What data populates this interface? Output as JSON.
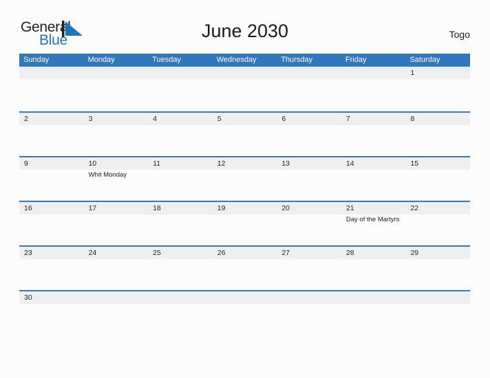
{
  "brand": {
    "word_one": "General",
    "word_two": "Blue",
    "flag_icon": "flag-triangle-icon",
    "dark_color": "#231f20",
    "blue_color": "#1b75bb"
  },
  "header": {
    "title": "June 2030",
    "country": "Togo"
  },
  "theme": {
    "header_blue": "#3177bd",
    "row_band_gray": "#efefef",
    "page_background": "#fcfcfc",
    "text_color": "#1a1a1a"
  },
  "calendar": {
    "weekdays": [
      "Sunday",
      "Monday",
      "Tuesday",
      "Wednesday",
      "Thursday",
      "Friday",
      "Saturday"
    ],
    "weeks": [
      {
        "days": [
          {
            "number": "",
            "events": []
          },
          {
            "number": "",
            "events": []
          },
          {
            "number": "",
            "events": []
          },
          {
            "number": "",
            "events": []
          },
          {
            "number": "",
            "events": []
          },
          {
            "number": "",
            "events": []
          },
          {
            "number": "1",
            "events": []
          }
        ]
      },
      {
        "days": [
          {
            "number": "2",
            "events": []
          },
          {
            "number": "3",
            "events": []
          },
          {
            "number": "4",
            "events": []
          },
          {
            "number": "5",
            "events": []
          },
          {
            "number": "6",
            "events": []
          },
          {
            "number": "7",
            "events": []
          },
          {
            "number": "8",
            "events": []
          }
        ]
      },
      {
        "days": [
          {
            "number": "9",
            "events": []
          },
          {
            "number": "10",
            "events": [
              "Whit Monday"
            ]
          },
          {
            "number": "11",
            "events": []
          },
          {
            "number": "12",
            "events": []
          },
          {
            "number": "13",
            "events": []
          },
          {
            "number": "14",
            "events": []
          },
          {
            "number": "15",
            "events": []
          }
        ]
      },
      {
        "days": [
          {
            "number": "16",
            "events": []
          },
          {
            "number": "17",
            "events": []
          },
          {
            "number": "18",
            "events": []
          },
          {
            "number": "19",
            "events": []
          },
          {
            "number": "20",
            "events": []
          },
          {
            "number": "21",
            "events": [
              "Day of the Martyrs"
            ]
          },
          {
            "number": "22",
            "events": []
          }
        ]
      },
      {
        "days": [
          {
            "number": "23",
            "events": []
          },
          {
            "number": "24",
            "events": []
          },
          {
            "number": "25",
            "events": []
          },
          {
            "number": "26",
            "events": []
          },
          {
            "number": "27",
            "events": []
          },
          {
            "number": "28",
            "events": []
          },
          {
            "number": "29",
            "events": []
          }
        ]
      },
      {
        "last": true,
        "days": [
          {
            "number": "30",
            "events": []
          },
          {
            "number": "",
            "events": []
          },
          {
            "number": "",
            "events": []
          },
          {
            "number": "",
            "events": []
          },
          {
            "number": "",
            "events": []
          },
          {
            "number": "",
            "events": []
          },
          {
            "number": "",
            "events": []
          }
        ]
      }
    ]
  }
}
